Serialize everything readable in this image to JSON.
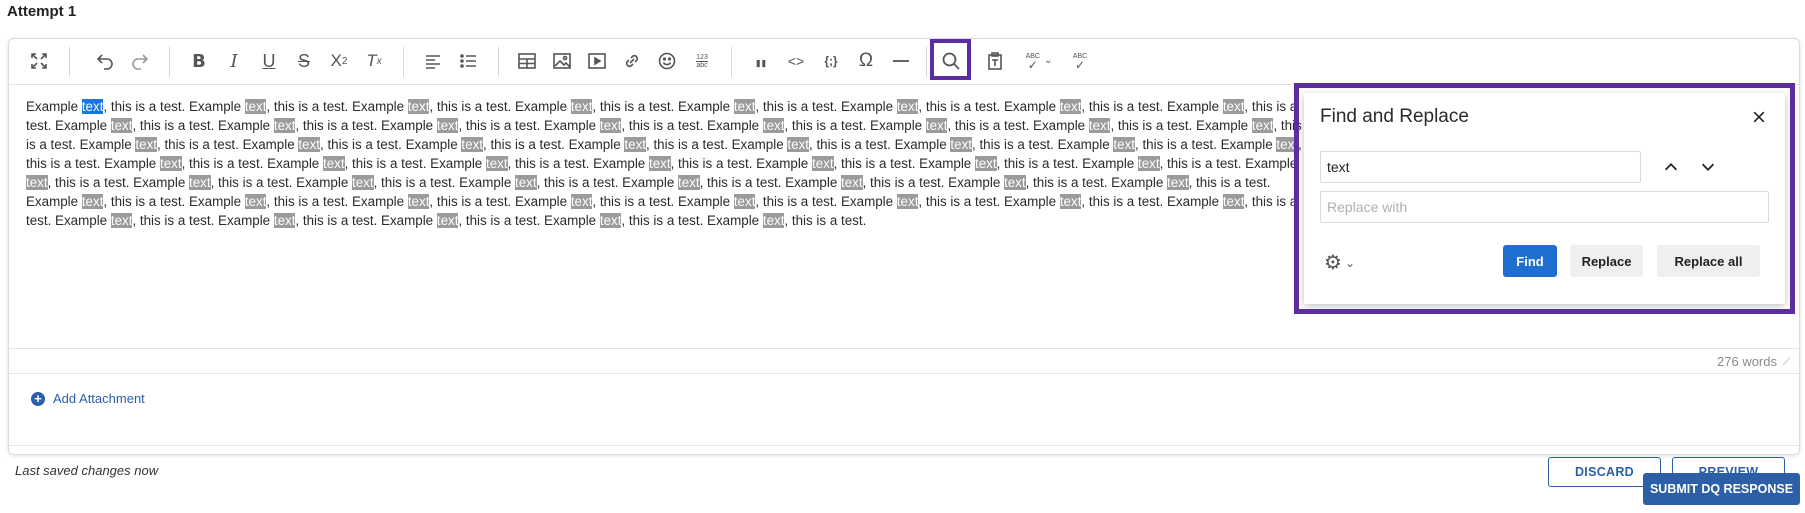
{
  "page": {
    "attempt_title": "Attempt 1"
  },
  "editor": {
    "paragraph": [
      {
        "t": "Example "
      },
      {
        "t": "text",
        "h": "cur"
      },
      {
        "t": ", this is a test. Example "
      },
      {
        "t": "text",
        "h": "hl"
      },
      {
        "t": ", this is a test. Example "
      },
      {
        "t": "text",
        "h": "hl"
      },
      {
        "t": ", this is a test. Example "
      },
      {
        "t": "text",
        "h": "hl"
      },
      {
        "t": ", this is a test. Example "
      },
      {
        "t": "text",
        "h": "hl"
      },
      {
        "t": ", this is a test. Example "
      },
      {
        "t": "text",
        "h": "hl"
      },
      {
        "t": ", this is a test. Example "
      },
      {
        "t": "text",
        "h": "hl"
      },
      {
        "t": ", this is a test. Example "
      },
      {
        "t": "text",
        "h": "hl"
      },
      {
        "t": ", this is a test. Example "
      },
      {
        "t": "text",
        "h": "hl"
      },
      {
        "t": ", this is a test. Example "
      },
      {
        "t": "text",
        "h": "hl"
      },
      {
        "t": ", this is a test. Example "
      },
      {
        "t": "text",
        "h": "hl"
      },
      {
        "t": ", this is a test. Example "
      },
      {
        "t": "text",
        "h": "hl"
      },
      {
        "t": ", this is a test. Example "
      },
      {
        "t": "text",
        "h": "hl"
      },
      {
        "t": ", this is a test. Example "
      },
      {
        "t": "text",
        "h": "hl"
      },
      {
        "t": ", this is a test. Example "
      },
      {
        "t": "text",
        "h": "hl"
      },
      {
        "t": ", this is a test. Example "
      },
      {
        "t": "text",
        "h": "hl"
      },
      {
        "t": ", this is a test. Example "
      },
      {
        "t": "text",
        "h": "hl"
      },
      {
        "t": ", this is a test. Example "
      },
      {
        "t": "text",
        "h": "hl"
      },
      {
        "t": ", this is a test. Example "
      },
      {
        "t": "text",
        "h": "hl"
      },
      {
        "t": ", this is a test. Example "
      },
      {
        "t": "text",
        "h": "hl"
      },
      {
        "t": ", this is a test. Example "
      },
      {
        "t": "text",
        "h": "hl"
      },
      {
        "t": ", this is a test. Example "
      },
      {
        "t": "text",
        "h": "hl"
      },
      {
        "t": ", this is a test. Example "
      },
      {
        "t": "text",
        "h": "hl"
      },
      {
        "t": ", this is a test. Example "
      },
      {
        "t": "text",
        "h": "hl"
      },
      {
        "t": ", this is a test. Example "
      },
      {
        "t": "text",
        "h": "hl"
      },
      {
        "t": ", this is a test. Example "
      },
      {
        "t": "text",
        "h": "hl"
      },
      {
        "t": ", this is a test. Example "
      },
      {
        "t": "text",
        "h": "hl"
      },
      {
        "t": ", this is a test. Example "
      },
      {
        "t": "text",
        "h": "hl"
      },
      {
        "t": ", this is a test. Example "
      },
      {
        "t": "text",
        "h": "hl"
      },
      {
        "t": ", this is a test. Example "
      },
      {
        "t": "text",
        "h": "hl"
      },
      {
        "t": ", this is a test. Example "
      },
      {
        "t": "text",
        "h": "hl"
      },
      {
        "t": ", this is a test. Example "
      },
      {
        "t": "text",
        "h": "hl"
      },
      {
        "t": ", this is a test. Example "
      },
      {
        "t": "text",
        "h": "hl"
      },
      {
        "t": ", this is a test. Example "
      },
      {
        "t": "text",
        "h": "hl"
      },
      {
        "t": ", this is a test. Example "
      },
      {
        "t": "text",
        "h": "hl"
      },
      {
        "t": ", this is a test. Example "
      },
      {
        "t": "text",
        "h": "hl"
      },
      {
        "t": ", this is a test. Example "
      },
      {
        "t": "text",
        "h": "hl"
      },
      {
        "t": ", this is a test. Example "
      },
      {
        "t": "text",
        "h": "hl"
      },
      {
        "t": ", this is a test. Example "
      },
      {
        "t": "text",
        "h": "hl"
      },
      {
        "t": ", this is a test. Example "
      },
      {
        "t": "text",
        "h": "hl"
      },
      {
        "t": ", this is a test. Example "
      },
      {
        "t": "text",
        "h": "hl"
      },
      {
        "t": ", this is a test. Example "
      },
      {
        "t": "text",
        "h": "hl"
      },
      {
        "t": ", this is a test. Example "
      },
      {
        "t": "text",
        "h": "hl"
      },
      {
        "t": ", this is a test. Example "
      },
      {
        "t": "text",
        "h": "hl"
      },
      {
        "t": ", this is a test. Example "
      },
      {
        "t": "text",
        "h": "hl"
      },
      {
        "t": ", this is a test. Example "
      },
      {
        "t": "text",
        "h": "hl"
      },
      {
        "t": ", this is a test. Example "
      },
      {
        "t": "text",
        "h": "hl"
      },
      {
        "t": ", this is a test. Example "
      },
      {
        "t": "text",
        "h": "hl"
      },
      {
        "t": ", this is a test. Example "
      },
      {
        "t": "text",
        "h": "hl"
      },
      {
        "t": ", this is a test. Example "
      },
      {
        "t": "text",
        "h": "hl"
      },
      {
        "t": ", this is a test. Example "
      },
      {
        "t": "text",
        "h": "hl"
      },
      {
        "t": ", this is a test. Example "
      },
      {
        "t": "text",
        "h": "hl"
      },
      {
        "t": ", this is a test."
      }
    ],
    "word_count": "276 words"
  },
  "attachment": {
    "label": "Add Attachment"
  },
  "footer": {
    "saved_text": "Last saved changes now",
    "discard_label": "DISCARD",
    "preview_label": "PREVIEW",
    "submit_label": "SUBMIT DQ RESPONSE"
  },
  "find_replace": {
    "title": "Find and Replace",
    "find_value": "text",
    "replace_placeholder": "Replace with",
    "find_label": "Find",
    "replace_label": "Replace",
    "replace_all_label": "Replace all"
  },
  "toolbar": {
    "items": [
      {
        "name": "fullscreen-icon"
      },
      {
        "name": "undo-icon"
      },
      {
        "name": "redo-icon"
      },
      {
        "name": "bold-icon"
      },
      {
        "name": "italic-icon"
      },
      {
        "name": "underline-icon"
      },
      {
        "name": "strikethrough-icon"
      },
      {
        "name": "superscript-icon"
      },
      {
        "name": "remove-format-icon"
      },
      {
        "name": "align-left-icon"
      },
      {
        "name": "bullet-list-icon"
      },
      {
        "name": "table-icon"
      },
      {
        "name": "image-icon"
      },
      {
        "name": "media-icon"
      },
      {
        "name": "link-icon"
      },
      {
        "name": "emoji-icon"
      },
      {
        "name": "word-count-icon"
      },
      {
        "name": "blockquote-icon"
      },
      {
        "name": "code-icon"
      },
      {
        "name": "code-block-icon"
      },
      {
        "name": "special-char-icon"
      },
      {
        "name": "horizontal-rule-icon"
      },
      {
        "name": "search-icon"
      },
      {
        "name": "paste-text-icon"
      },
      {
        "name": "spellcheck-icon"
      },
      {
        "name": "spellcheck-language-icon"
      }
    ]
  },
  "colors": {
    "accent": "#5b2d9e",
    "primary": "#2b5fa8",
    "find_button": "#1f6fd1",
    "highlight": "#9b9b9b",
    "current_highlight": "#1a73e8"
  }
}
